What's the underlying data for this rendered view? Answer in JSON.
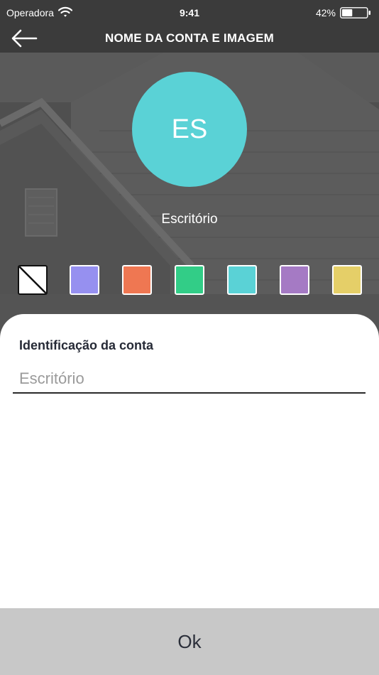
{
  "status_bar": {
    "carrier": "Operadora",
    "time": "9:41",
    "battery_percent": "42%",
    "battery_level": 0.42
  },
  "header": {
    "title": "NOME DA CONTA E IMAGEM",
    "back_icon": "arrow-left-icon"
  },
  "profile": {
    "initials": "ES",
    "name": "Escritório",
    "avatar_color": "#5ad2d6"
  },
  "color_swatches": [
    {
      "name": "none",
      "color": "#ffffff"
    },
    {
      "name": "lavender",
      "color": "#9690f0"
    },
    {
      "name": "coral",
      "color": "#ef7752"
    },
    {
      "name": "green",
      "color": "#32cd87"
    },
    {
      "name": "cyan",
      "color": "#5ad2d6"
    },
    {
      "name": "purple",
      "color": "#a57ac4"
    },
    {
      "name": "yellow",
      "color": "#e5cf68"
    }
  ],
  "form": {
    "label": "Identificação da conta",
    "placeholder": "Escritório",
    "value": ""
  },
  "footer": {
    "ok_label": "Ok"
  }
}
